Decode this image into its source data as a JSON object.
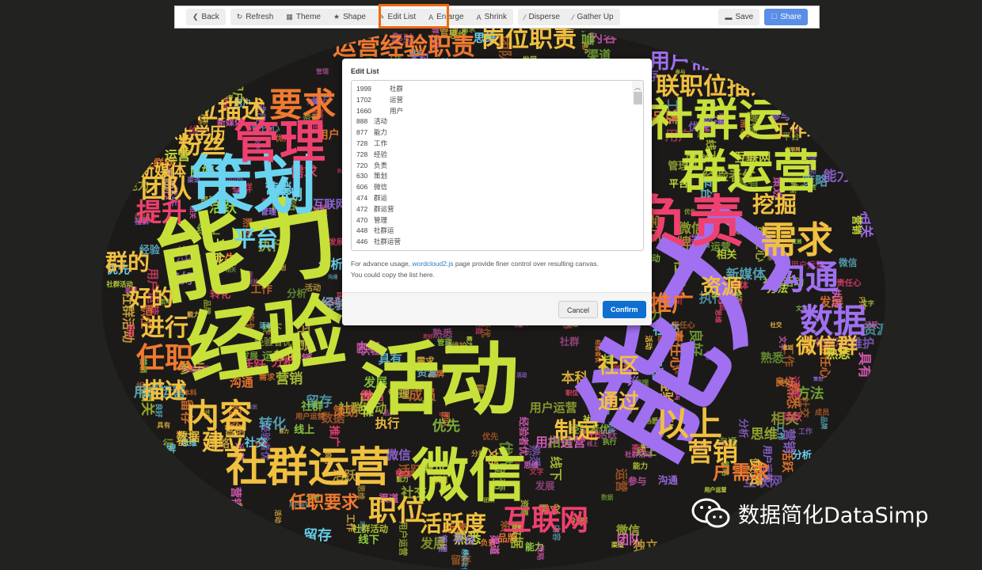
{
  "toolbar": {
    "back": "Back",
    "refresh": "Refresh",
    "theme": "Theme",
    "shape": "Shape",
    "edit_list": "Edit List",
    "enlarge": "Enlarge",
    "shrink": "Shrink",
    "disperse": "Disperse",
    "gather_up": "Gather Up",
    "save": "Save",
    "share": "Share"
  },
  "dialog": {
    "title": "Edit List",
    "list": [
      {
        "n": "1999",
        "w": "社群"
      },
      {
        "n": "1702",
        "w": "运营"
      },
      {
        "n": "1660",
        "w": "用户"
      },
      {
        "n": "888",
        "w": "活动"
      },
      {
        "n": "877",
        "w": "能力"
      },
      {
        "n": "728",
        "w": "工作"
      },
      {
        "n": "728",
        "w": "经验"
      },
      {
        "n": "720",
        "w": "负责"
      },
      {
        "n": "630",
        "w": "策划"
      },
      {
        "n": "606",
        "w": "微信"
      },
      {
        "n": "474",
        "w": "群运"
      },
      {
        "n": "472",
        "w": "群运营"
      },
      {
        "n": "470",
        "w": "管理"
      },
      {
        "n": "448",
        "w": "社群运"
      },
      {
        "n": "446",
        "w": "社群运营"
      }
    ],
    "help_before": "For advance usage, ",
    "help_link": "wordcloud2.js",
    "help_after": " page provide finer control over resulting canvas.",
    "help_line2": "You could copy the list here.",
    "cancel": "Cancel",
    "confirm": "Confirm"
  },
  "cloud": {
    "palette": [
      "#c8e03a",
      "#f0c040",
      "#f07a30",
      "#f04070",
      "#a070f0",
      "#6ad4f0",
      "#e060c0",
      "#90d040"
    ],
    "big_words": [
      "运营",
      "能力",
      "经验",
      "活动",
      "策划",
      "社群运营",
      "微信",
      "负责",
      "社群运",
      "群运营",
      "管理",
      "要求",
      "需求",
      "沟通",
      "数据",
      "互联网",
      "职位",
      "活跃度",
      "内容",
      "岗位职责",
      "运营经验职责",
      "联职位描述",
      "营销",
      "以上",
      "任职",
      "提升",
      "团队",
      "平台",
      "工作经验",
      "挖掘",
      "推广",
      "资源",
      "粉丝",
      "新媒体",
      "位描述",
      "微信群",
      "描述",
      "建立",
      "进行",
      "好的",
      "群的",
      "以上学历",
      "任职要求",
      "通过",
      "制定",
      "户需求",
      "用户需求",
      "社区"
    ],
    "small_words": [
      "用户",
      "社群",
      "运营",
      "活动",
      "策划",
      "能力",
      "经验",
      "工作",
      "负责",
      "微信",
      "管理",
      "数据",
      "沟通",
      "需求",
      "学历",
      "优先",
      "团队",
      "平台",
      "推广",
      "内容",
      "营销",
      "维护",
      "文字",
      "执行",
      "方法",
      "资源",
      "互联网",
      "新媒体",
      "分析",
      "社交",
      "思维",
      "发展",
      "参与",
      "有效",
      "成员",
      "经验者优",
      "职位",
      "本科",
      "相关",
      "熟悉",
      "具有",
      "良好",
      "责任心",
      "用户运营",
      "社群活动",
      "独立",
      "策略",
      "渠道",
      "线下",
      "线上",
      "转化",
      "留存",
      "品牌",
      "活跃"
    ]
  },
  "colors": {
    "highlight": "#f06a10",
    "share": "#5b8ee6",
    "confirm": "#0e6fd1",
    "link": "#2a7ac6"
  },
  "watermark": "数据简化DataSimp"
}
